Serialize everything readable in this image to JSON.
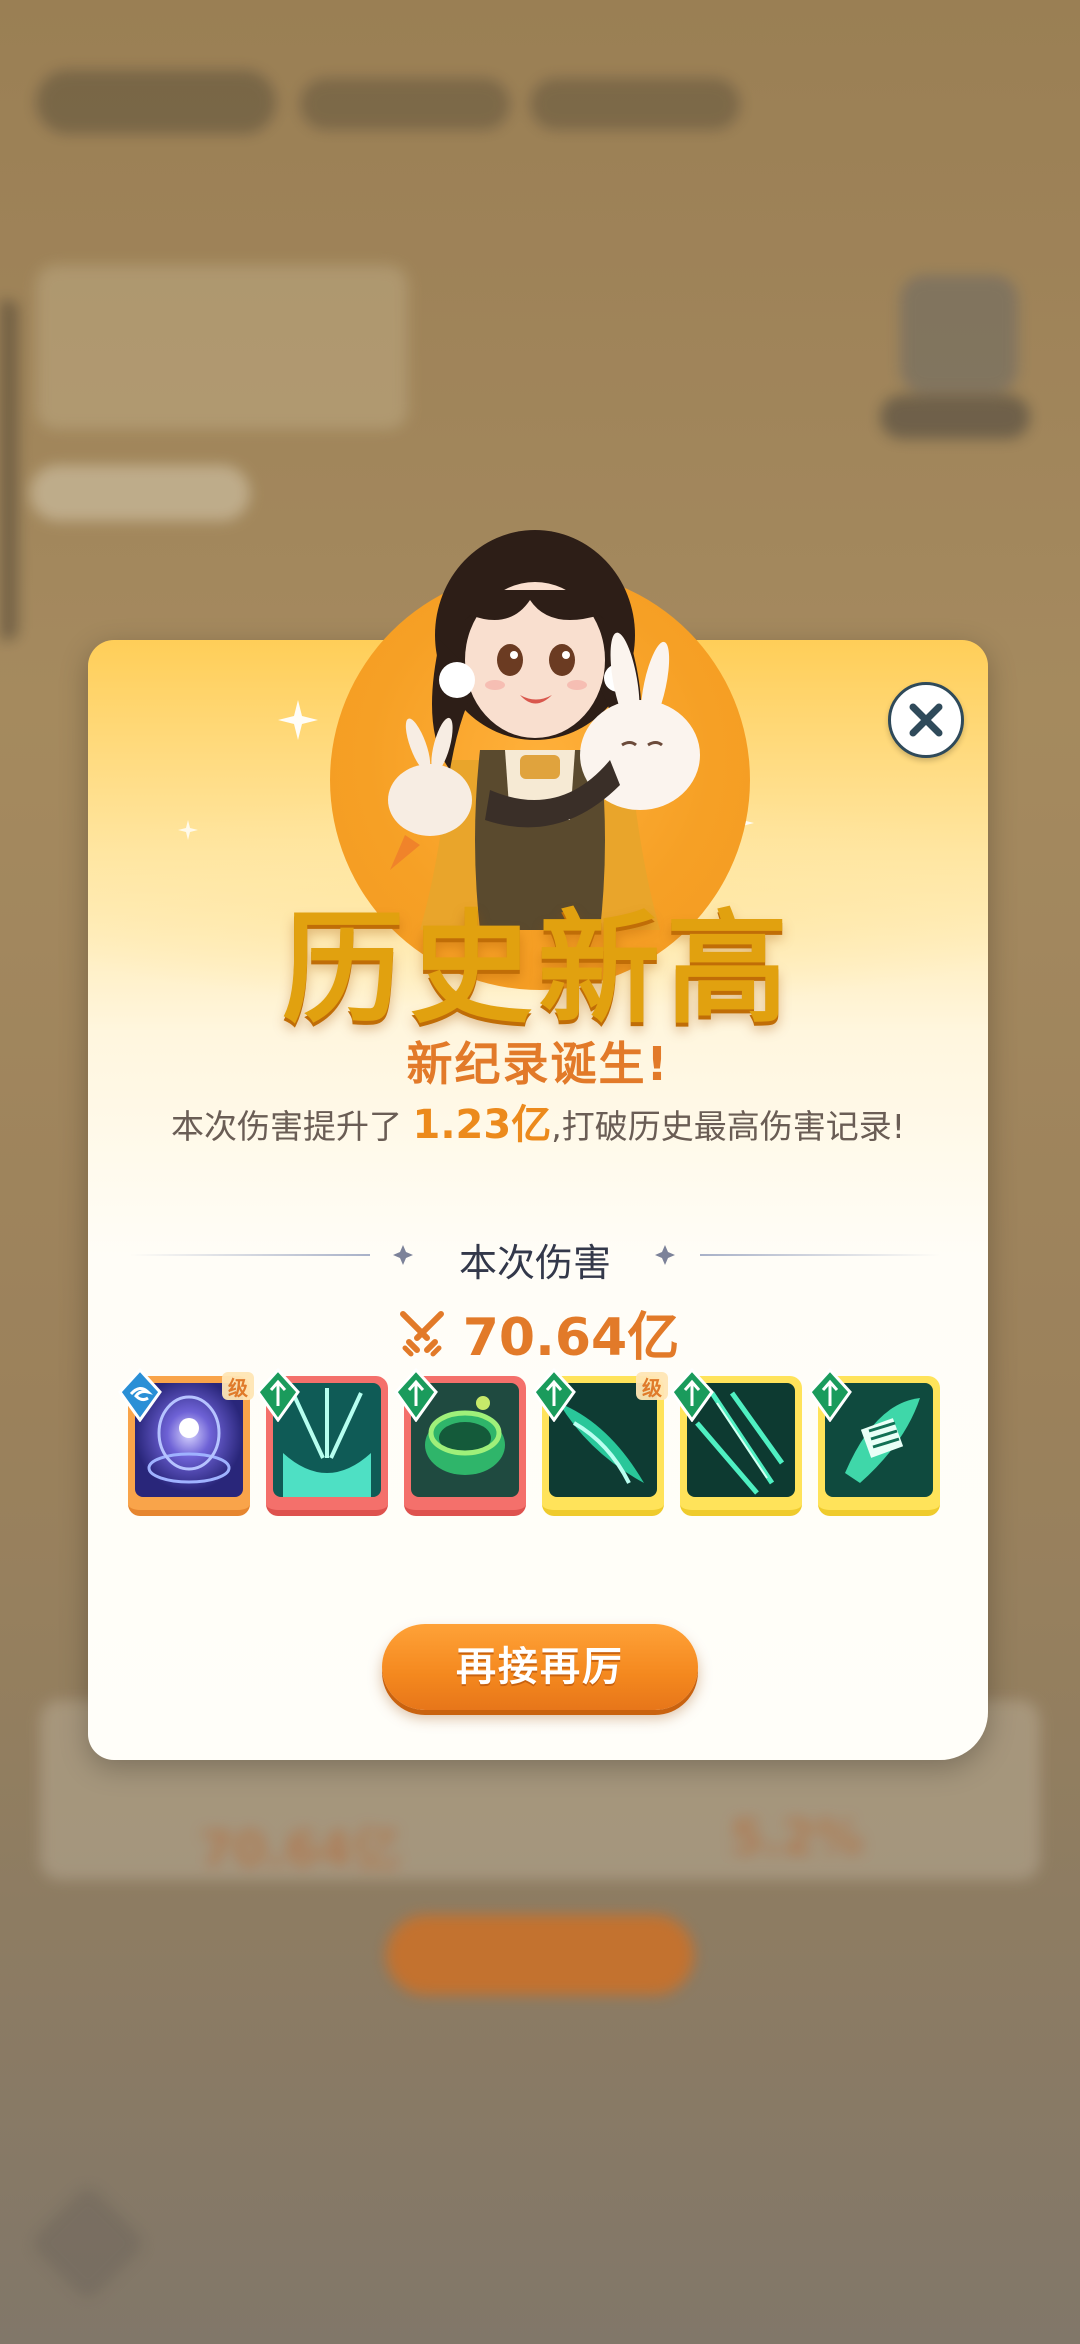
{
  "dialog": {
    "title": "历史新高",
    "subtitle": "新纪录诞生!",
    "description_prefix": "本次伤害提升了",
    "description_highlight": "1.23亿",
    "description_suffix": ",打破历史最高伤害记录!",
    "section_label": "本次伤害",
    "damage_value": "70.64亿",
    "skills": [
      {
        "name": "skill-1",
        "rarity": "orange",
        "element": "blue",
        "level_mark": "级"
      },
      {
        "name": "skill-2",
        "rarity": "red",
        "element": "green",
        "level_mark": ""
      },
      {
        "name": "skill-3",
        "rarity": "red",
        "element": "green",
        "level_mark": ""
      },
      {
        "name": "skill-4",
        "rarity": "yellow",
        "element": "green",
        "level_mark": "级"
      },
      {
        "name": "skill-5",
        "rarity": "yellow",
        "element": "green",
        "level_mark": ""
      },
      {
        "name": "skill-6",
        "rarity": "yellow",
        "element": "green",
        "level_mark": ""
      }
    ],
    "button_label": "再接再厉"
  },
  "background": {
    "left_value": "70.64亿",
    "right_value": "5.2%"
  },
  "colors": {
    "accent_orange": "#e27a29",
    "title_gold": "#e1a10f",
    "button_orange": "#f4881e"
  }
}
